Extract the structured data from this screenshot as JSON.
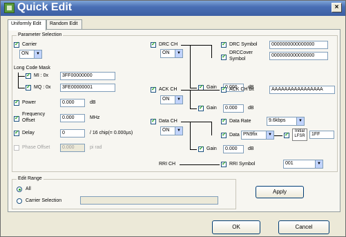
{
  "window": {
    "title": "Quick Edit",
    "close_label": "×"
  },
  "tabs": [
    {
      "label": "Uniformly Edit"
    },
    {
      "label": "Random Edit"
    }
  ],
  "param": {
    "group_title": "Parameter Selection",
    "carrier": {
      "label": "Carrier",
      "value": "ON"
    },
    "long_code_mask": "Long Code Mask",
    "mi": {
      "label": "MI : 0x",
      "value": "3FF00000000"
    },
    "mq": {
      "label": "MQ : 0x",
      "value": "3FE00000001"
    },
    "power": {
      "label": "Power",
      "value": "0.000",
      "unit": "dB"
    },
    "freq": {
      "label1": "Frequency",
      "label2": "Offset",
      "value": "0.000",
      "unit": "MHz"
    },
    "delay": {
      "label": "Delay",
      "value": "0",
      "unit": "/ 16 chip(= 0.000µs)"
    },
    "phase": {
      "label": "Phase Offset",
      "value": "0.000",
      "unit": "pi rad"
    },
    "drc": {
      "label": "DRC CH",
      "value": "ON",
      "symbol_label": "DRC Symbol",
      "symbol_value": "0000000000000000",
      "cover_label1": "DRCCover",
      "cover_label2": "Symbol",
      "cover_value": "0000000000000000",
      "gain_label": "Gain",
      "gain_value": "0.000",
      "gain_unit": "dB"
    },
    "ack": {
      "label": "ACK CH",
      "value": "ON",
      "bit_label": "ACK CH bit",
      "bit_value": "AAAAAAAAAAAAAAAA",
      "gain_label": "Gain",
      "gain_value": "0.000",
      "gain_unit": "dB"
    },
    "data": {
      "label": "Data CH",
      "value": "ON",
      "rate_label": "Data Rate",
      "rate_value": "9.6kbps",
      "data_label": "Data",
      "data_value": "PN9fix",
      "initial_label1": "Initial",
      "initial_label2": "LFSR",
      "initial_value": "1FF",
      "gain_label": "Gain",
      "gain_value": "0.000",
      "gain_unit": "dB"
    },
    "rri": {
      "label": "RRI CH",
      "symbol_label": "RRI Symbol",
      "symbol_value": "001"
    }
  },
  "edit_range": {
    "group_title": "Edit Range",
    "all_label": "All",
    "carrier_selection_label": "Carrier Selection",
    "carrier_selection_value": ""
  },
  "buttons": {
    "apply": "Apply",
    "ok": "OK",
    "cancel": "Cancel"
  }
}
